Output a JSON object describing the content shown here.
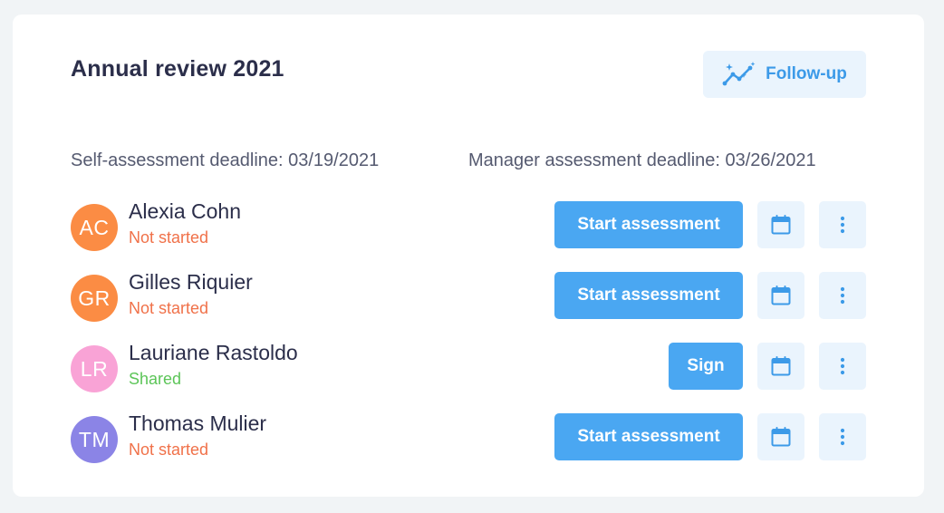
{
  "header": {
    "title": "Annual review 2021",
    "followup_label": "Follow-up"
  },
  "deadlines": {
    "self": "Self-assessment deadline: 03/19/2021",
    "manager": "Manager assessment deadline: 03/26/2021"
  },
  "people": [
    {
      "initials": "AC",
      "name": "Alexia Cohn",
      "status": "Not started",
      "status_kind": "not-started",
      "avatar_color": "#fb8c44",
      "action_label": "Start assessment"
    },
    {
      "initials": "GR",
      "name": "Gilles Riquier",
      "status": "Not started",
      "status_kind": "not-started",
      "avatar_color": "#fb8c44",
      "action_label": "Start assessment"
    },
    {
      "initials": "LR",
      "name": "Lauriane Rastoldo",
      "status": "Shared",
      "status_kind": "shared",
      "avatar_color": "#f9a3d6",
      "action_label": "Sign"
    },
    {
      "initials": "TM",
      "name": "Thomas Mulier",
      "status": "Not started",
      "status_kind": "not-started",
      "avatar_color": "#8b84e6",
      "action_label": "Start assessment"
    }
  ],
  "icons": {
    "followup": "sparkle-trend-icon",
    "calendar": "calendar-icon",
    "more": "more-vertical-icon"
  },
  "colors": {
    "primary": "#4aa7f2",
    "primary_light": "#eaf4fd",
    "not_started": "#f07149",
    "shared": "#5cc558",
    "text": "#2b2e4a"
  }
}
